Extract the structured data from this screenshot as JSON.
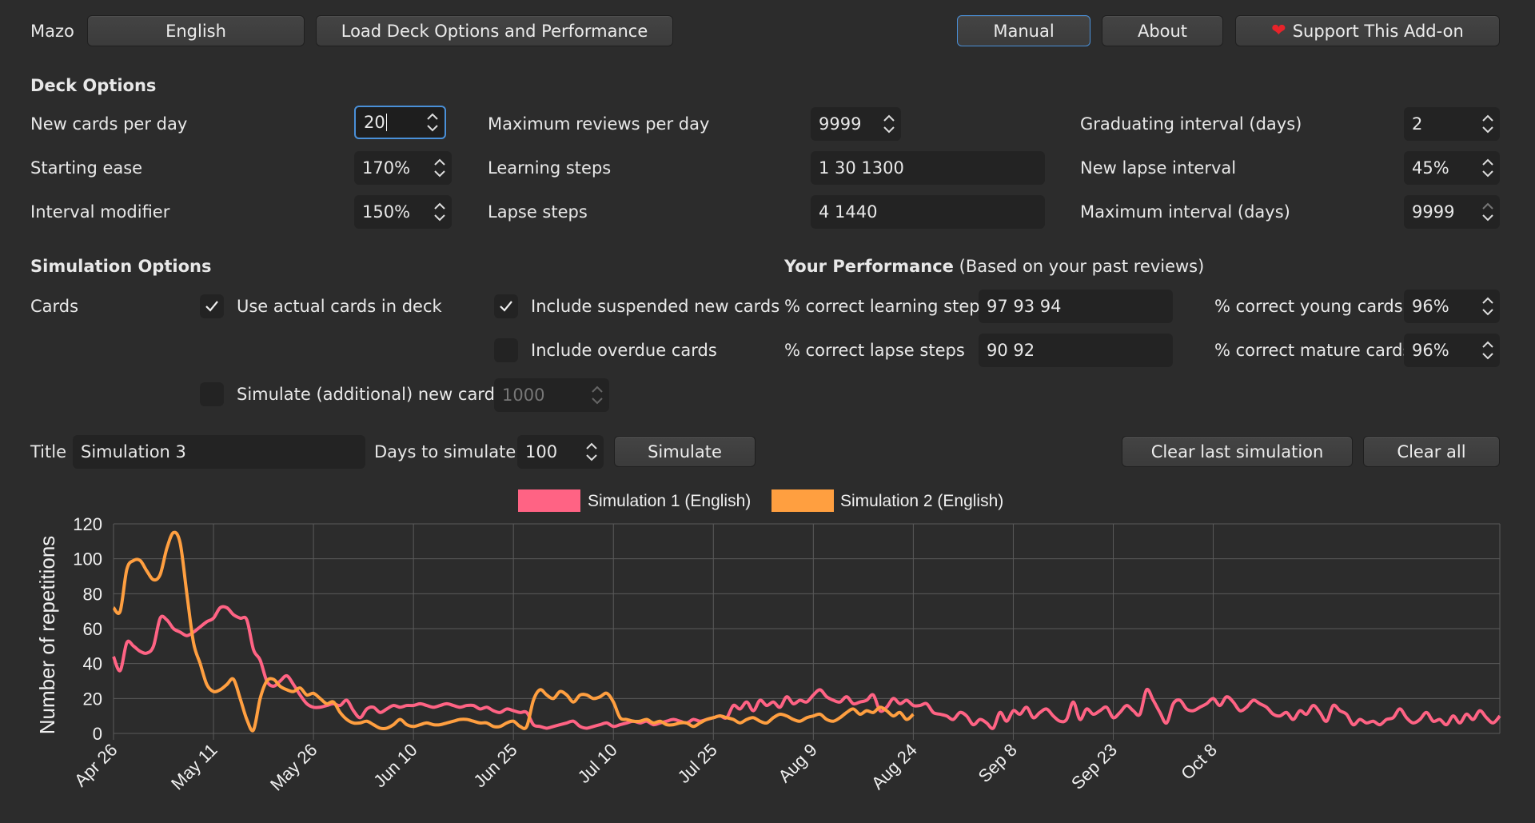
{
  "header": {
    "app_name": "Mazo",
    "deck_select": "English",
    "load_button": "Load Deck Options and Performance",
    "manual_button": "Manual",
    "about_button": "About",
    "support_button": "Support This Add-on",
    "support_icon": "heart-icon"
  },
  "deck_options": {
    "title": "Deck Options",
    "new_cards_label": "New cards per day",
    "new_cards_value": "20",
    "starting_ease_label": "Starting ease",
    "starting_ease_value": "170%",
    "interval_modifier_label": "Interval modifier",
    "interval_modifier_value": "150%",
    "max_reviews_label": "Maximum reviews per day",
    "max_reviews_value": "9999",
    "learning_steps_label": "Learning steps",
    "learning_steps_value": "1 30 1300",
    "lapse_steps_label": "Lapse steps",
    "lapse_steps_value": "4 1440",
    "graduating_label": "Graduating interval (days)",
    "graduating_value": "2",
    "new_lapse_label": "New lapse interval",
    "new_lapse_value": "45%",
    "max_interval_label": "Maximum interval (days)",
    "max_interval_value": "9999"
  },
  "simulation_options": {
    "title": "Simulation Options",
    "cards_label": "Cards",
    "use_actual_label": "Use actual cards in deck",
    "use_actual_checked": true,
    "include_suspended_label": "Include suspended new cards",
    "include_suspended_checked": true,
    "include_overdue_label": "Include overdue cards",
    "include_overdue_checked": false,
    "simulate_new_label": "Simulate (additional) new cards:",
    "simulate_new_checked": false,
    "simulate_new_value": "1000"
  },
  "performance": {
    "title": "Your Performance",
    "subtitle": "(Based on your past reviews)",
    "learning_label": "% correct learning steps",
    "learning_value": "97 93 94",
    "lapse_label": "% correct lapse steps",
    "lapse_value": "90 92",
    "young_label": "% correct young cards",
    "young_value": "96%",
    "mature_label": "% correct mature cards",
    "mature_value": "96%"
  },
  "run": {
    "title_label": "Title",
    "title_value": "Simulation 3",
    "days_label": "Days to simulate",
    "days_value": "100",
    "simulate_button": "Simulate",
    "clear_last_button": "Clear last simulation",
    "clear_all_button": "Clear all"
  },
  "chart_data": {
    "type": "line",
    "ylabel": "Number of repetitions",
    "xlabel": "",
    "ylim": [
      0,
      120
    ],
    "yticks": [
      0,
      20,
      40,
      60,
      80,
      100,
      120
    ],
    "x_start": "Apr 26",
    "x_tick_labels": [
      "Apr 26",
      "May 11",
      "May 26",
      "Jun 10",
      "Jun 25",
      "Jul 10",
      "Jul 25",
      "Aug 9",
      "Aug 24",
      "Sep 8",
      "Sep 23",
      "Oct 8"
    ],
    "legend_position": "top",
    "grid": true,
    "series": [
      {
        "name": "Simulation 1 (English)",
        "color": "#ff6384",
        "values": [
          44,
          36,
          52,
          50,
          47,
          46,
          50,
          66,
          65,
          60,
          58,
          56,
          58,
          61,
          64,
          66,
          72,
          72,
          68,
          66,
          65,
          48,
          42,
          30,
          27,
          30,
          33,
          28,
          22,
          17,
          15,
          15,
          16,
          17,
          16,
          19,
          13,
          9,
          14,
          15,
          12,
          14,
          16,
          15,
          16,
          16,
          17,
          16,
          15,
          16,
          17,
          16,
          15,
          16,
          16,
          14,
          15,
          13,
          12,
          14,
          13,
          12,
          12,
          5,
          4,
          3,
          4,
          5,
          6,
          7,
          4,
          3,
          4,
          5,
          6,
          4,
          5,
          6,
          7,
          6,
          7,
          5,
          6,
          7,
          8,
          7,
          6,
          8,
          7,
          8,
          9,
          10,
          9,
          16,
          14,
          18,
          13,
          19,
          16,
          18,
          15,
          21,
          17,
          19,
          18,
          22,
          25,
          21,
          19,
          18,
          21,
          17,
          18,
          19,
          22,
          13,
          15,
          20,
          17,
          19,
          16,
          16,
          17,
          12,
          11,
          10,
          8,
          12,
          10,
          5,
          8,
          6,
          3,
          12,
          7,
          13,
          11,
          15,
          9,
          12,
          14,
          10,
          7,
          8,
          18,
          8,
          14,
          11,
          13,
          15,
          9,
          12,
          16,
          13,
          11,
          25,
          19,
          12,
          6,
          17,
          19,
          14,
          13,
          15,
          17,
          20,
          16,
          21,
          18,
          13,
          15,
          19,
          17,
          15,
          11,
          10,
          12,
          8,
          13,
          11,
          16,
          12,
          7,
          16,
          13,
          11,
          5,
          8,
          6,
          7,
          5,
          8,
          9,
          14,
          9,
          6,
          8,
          12,
          7,
          8,
          5,
          10,
          6,
          11,
          8,
          13,
          9,
          6,
          10
        ]
      },
      {
        "name": "Simulation 2 (English)",
        "color": "#ff9f40",
        "values": [
          72,
          70,
          94,
          99,
          99,
          93,
          88,
          91,
          106,
          115,
          109,
          80,
          52,
          40,
          28,
          24,
          25,
          28,
          31,
          20,
          8,
          2,
          20,
          30,
          31,
          27,
          25,
          24,
          26,
          22,
          23,
          20,
          17,
          18,
          12,
          8,
          6,
          6,
          7,
          5,
          3,
          3,
          5,
          8,
          5,
          4,
          5,
          6,
          5,
          5,
          6,
          7,
          8,
          8,
          7,
          6,
          6,
          4,
          4,
          6,
          7,
          4,
          4,
          19,
          25,
          22,
          20,
          24,
          22,
          18,
          22,
          22,
          20,
          21,
          23,
          18,
          9,
          8,
          7,
          7,
          8,
          6,
          7,
          5,
          5,
          6,
          6,
          4,
          6,
          8,
          9,
          10,
          9,
          8,
          6,
          8,
          9,
          7,
          6,
          9,
          11,
          10,
          8,
          7,
          9,
          10,
          11,
          8,
          7,
          9,
          12,
          14,
          11,
          13,
          12,
          15,
          13,
          10,
          12,
          8,
          11
        ]
      }
    ]
  }
}
